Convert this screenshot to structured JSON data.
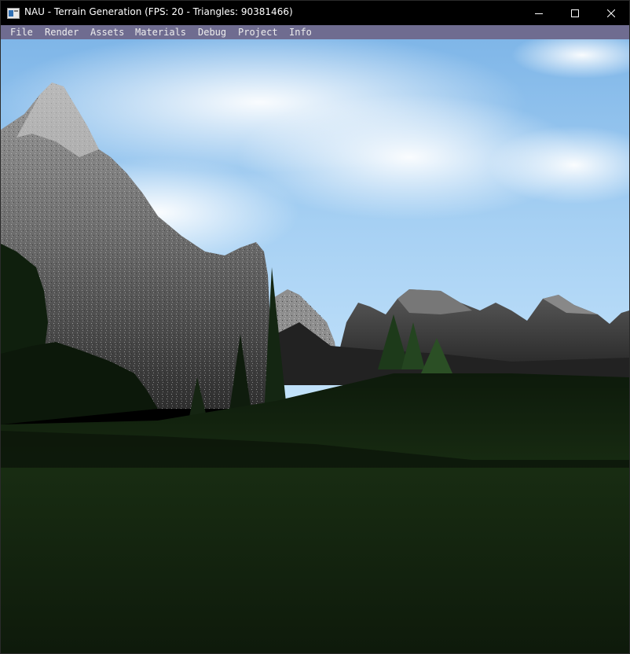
{
  "window": {
    "title": "NAU - Terrain Generation (FPS: 20 - Triangles: 90381466)"
  },
  "controls": {
    "minimize_icon": "minimize-icon",
    "maximize_icon": "maximize-icon",
    "close_icon": "close-icon"
  },
  "menu": {
    "items": [
      {
        "label": "File"
      },
      {
        "label": "Render"
      },
      {
        "label": "Assets"
      },
      {
        "label": "Materials"
      },
      {
        "label": "Debug"
      },
      {
        "label": "Project"
      },
      {
        "label": "Info"
      }
    ]
  },
  "colors": {
    "menubar": "#6f6c90",
    "sky": "#a9d4f2",
    "grass": "#15250f",
    "rock": "#5f5f5f"
  }
}
